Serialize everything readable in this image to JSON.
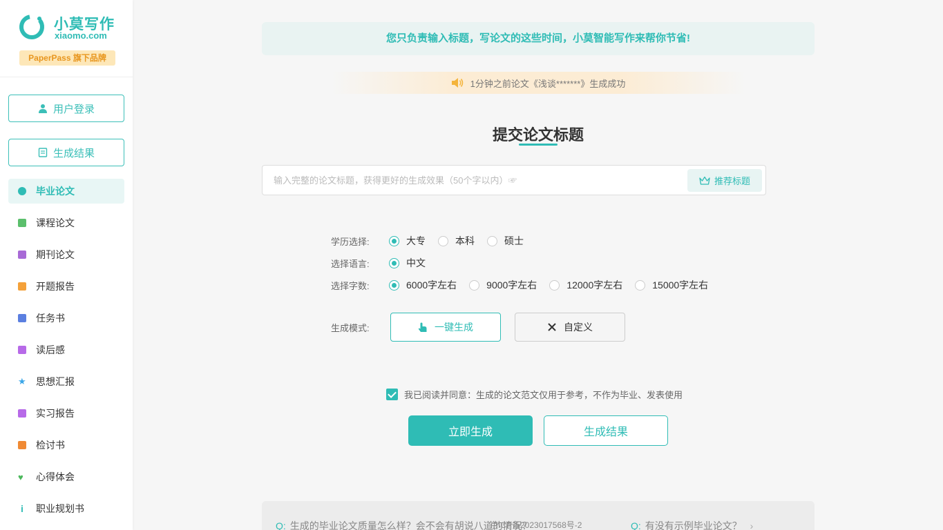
{
  "logo": {
    "title": "小莫写作",
    "domain": "xiaomo.com",
    "brand_badge": "PaperPass 旗下品牌",
    "color": "#2fbcb5"
  },
  "sidebar": {
    "login_label": "用户登录",
    "results_label": "生成结果",
    "items": [
      {
        "label": "毕业论文",
        "icon": "graduation-cap-icon",
        "color": "#2fbcb5",
        "active": true
      },
      {
        "label": "课程论文",
        "icon": "course-icon",
        "color": "#5bbf6c"
      },
      {
        "label": "期刊论文",
        "icon": "journal-icon",
        "color": "#a86ad6"
      },
      {
        "label": "开题报告",
        "icon": "proposal-icon",
        "color": "#f4a13a"
      },
      {
        "label": "任务书",
        "icon": "task-icon",
        "color": "#5b7fe0"
      },
      {
        "label": "读后感",
        "icon": "reading-icon",
        "color": "#b76ae8"
      },
      {
        "label": "思想汇报",
        "icon": "star-icon",
        "color": "#3aa6e8"
      },
      {
        "label": "实习报告",
        "icon": "internship-icon",
        "color": "#b76ae8"
      },
      {
        "label": "检讨书",
        "icon": "envelope-icon",
        "color": "#f08a34"
      },
      {
        "label": "心得体会",
        "icon": "heart-icon",
        "color": "#4cb85c"
      },
      {
        "label": "职业规划书",
        "icon": "info-icon",
        "color": "#2fbcb5"
      }
    ]
  },
  "banner": {
    "text": "您只负责输入标题，写论文的这些时间，小莫智能写作来帮你节省!"
  },
  "notice": {
    "text": "1分钟之前论文《浅谈*******》生成成功"
  },
  "form": {
    "heading": "提交论文标题",
    "title_placeholder": "输入完整的论文标题，获得更好的生成效果（50个字以内）☞",
    "recommend_label": "推荐标题",
    "education": {
      "label": "学历选择:",
      "options": [
        "大专",
        "本科",
        "硕士"
      ],
      "selected": "大专"
    },
    "language": {
      "label": "选择语言:",
      "options": [
        "中文"
      ],
      "selected": "中文"
    },
    "word_count": {
      "label": "选择字数:",
      "options": [
        "6000字左右",
        "9000字左右",
        "12000字左右",
        "15000字左右"
      ],
      "selected": "6000字左右"
    },
    "mode": {
      "label": "生成模式:",
      "one_click": "一键生成",
      "custom": "自定义"
    },
    "agreement": "我已阅读并同意：生成的论文范文仅用于参考，不作为毕业、发表使用",
    "agreed": true,
    "generate_label": "立即生成",
    "results_label": "生成结果"
  },
  "faq": {
    "q_mark": "Q:",
    "q1": "生成的毕业论文质量怎么样？会不会有胡说八道的情况？",
    "q2": "有没有示例毕业论文？",
    "arrow": "›"
  },
  "icp": "京ICP备2023017568号-2"
}
